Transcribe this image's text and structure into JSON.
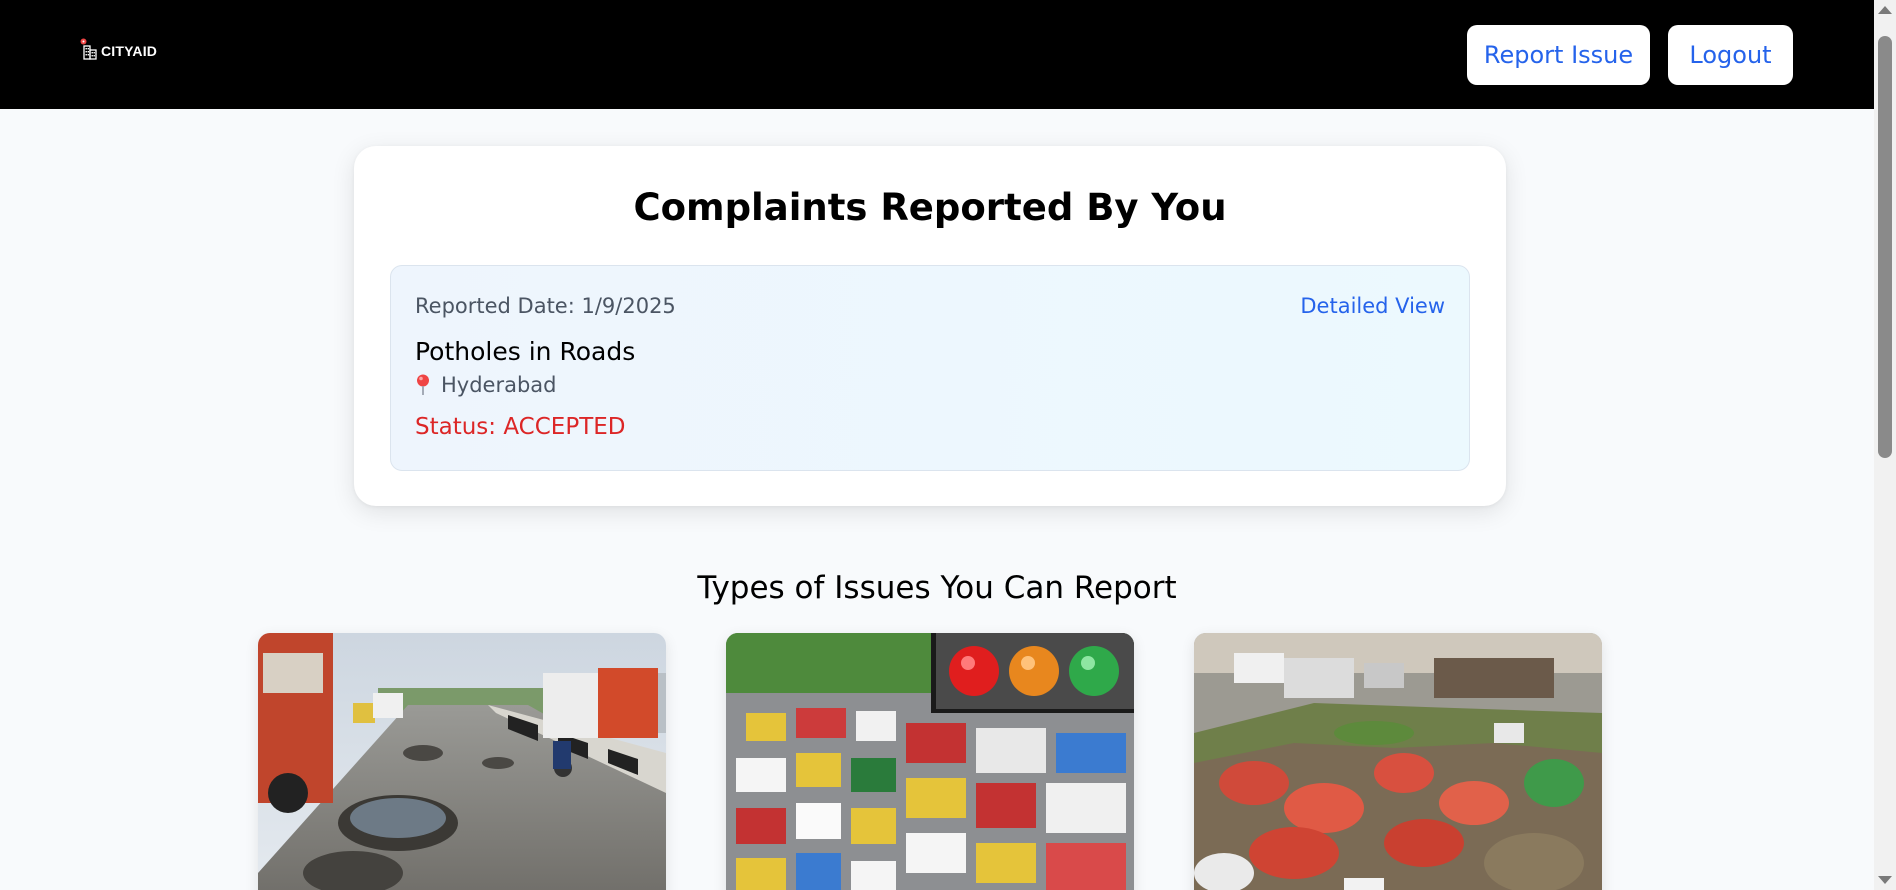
{
  "header": {
    "logo_text": "CITYAID",
    "report_issue_label": "Report Issue",
    "logout_label": "Logout"
  },
  "complaints": {
    "title": "Complaints Reported By You",
    "items": [
      {
        "reported_date": "Reported Date: 1/9/2025",
        "detailed_view_label": "Detailed View",
        "issue": "Potholes in Roads",
        "location": "Hyderabad",
        "status": "Status: ACCEPTED"
      }
    ]
  },
  "issue_types": {
    "title": "Types of Issues You Can Report",
    "cards": [
      {
        "image": "potholes-road-photo"
      },
      {
        "image": "traffic-congestion-photo"
      },
      {
        "image": "garbage-dump-photo"
      }
    ]
  },
  "colors": {
    "header_bg": "#000000",
    "accent_blue": "#2563eb",
    "status_red": "#dc2626",
    "page_bg": "#f8fafc"
  }
}
